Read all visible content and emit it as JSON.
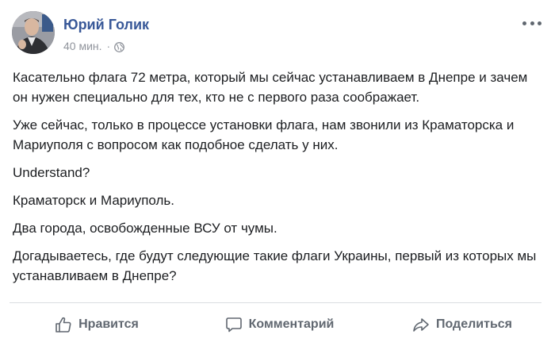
{
  "post": {
    "author": {
      "name": "Юрий Голик"
    },
    "meta": {
      "timestamp": "40 мин.",
      "separator": "·",
      "privacy_icon": "globe-icon"
    },
    "menu_icon": "more-options-icon",
    "paragraphs": [
      "Касательно флага 72 метра, который мы сейчас устанавливаем в Днепре и зачем он нужен специально для тех, кто не с первого раза соображает.",
      "Уже сейчас, только в процессе установки флага, нам звонили из Краматорска и Мариуполя с вопросом как подобное сделать у них.",
      "Understand?",
      "Краматорск и Мариуполь.",
      "Два города, освобожденные ВСУ от чумы.",
      "Догадываетесь, где будут следующие такие флаги Украины, первый из которых мы устанавливаем в Днепре?"
    ]
  },
  "actions": {
    "like_label": "Нравится",
    "comment_label": "Комментарий",
    "share_label": "Поделиться"
  },
  "colors": {
    "author_link": "#385898",
    "meta_text": "#90949c",
    "body_text": "#1c1e21",
    "action_text": "#606770",
    "divider": "#dadde1"
  }
}
